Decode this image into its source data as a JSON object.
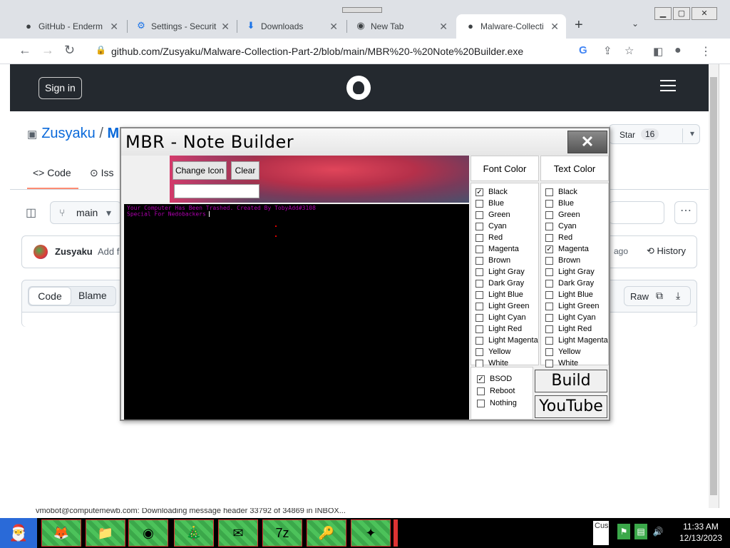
{
  "browser": {
    "tabs": [
      {
        "title": "GitHub - Enderm",
        "icon": "github-icon"
      },
      {
        "title": "Settings - Securit",
        "icon": "gear-icon"
      },
      {
        "title": "Downloads",
        "icon": "download-icon"
      },
      {
        "title": "New Tab",
        "icon": "chrome-icon"
      },
      {
        "title": "Malware-Collecti",
        "icon": "github-icon",
        "active": true
      }
    ],
    "url": "github.com/Zusyaku/Malware-Collection-Part-2/blob/main/MBR%20-%20Note%20Builder.exe",
    "google_badge": "G"
  },
  "github": {
    "signin": "Sign in",
    "repo_owner": "Zusyaku",
    "repo_sep": "/",
    "repo_name_initial": "M",
    "star_label": "Star",
    "star_count": "16",
    "tabs": {
      "code": "Code",
      "issues": "Iss"
    },
    "branch": "main",
    "commit_user": "Zusyaku",
    "commit_msg": "Add f",
    "commit_ago": "ago",
    "history": "History",
    "view_code": "Code",
    "view_blame": "Blame",
    "raw": "Raw"
  },
  "mbr": {
    "title": "MBR - Note Builder",
    "close": "✕",
    "change_icon": "Change Icon",
    "clear": "Clear",
    "note_line1": "Your Computer Has Been Trashed. Created By TobyAdd#3108",
    "note_line2": "Special For Nedobackers",
    "font_color_label": "Font Color",
    "text_color_label": "Text Color",
    "colors": [
      "Black",
      "Blue",
      "Green",
      "Cyan",
      "Red",
      "Magenta",
      "Brown",
      "Light Gray",
      "Dark Gray",
      "Light Blue",
      "Light Green",
      "Light Cyan",
      "Light Red",
      "Light Magenta",
      "Yellow",
      "White"
    ],
    "font_color_checked": "Black",
    "text_color_checked": "Magenta",
    "modes": [
      {
        "label": "BSOD",
        "checked": true
      },
      {
        "label": "Reboot",
        "checked": false
      },
      {
        "label": "Nothing",
        "checked": false
      }
    ],
    "build": "Build",
    "youtube": "YouTube"
  },
  "status": {
    "text": "vmobot@computemewb.com: Downloading message header 33792 of 34869 in INBOX..."
  },
  "taskbar": {
    "search_stub": "Cus",
    "time": "11:33 AM",
    "date": "12/13/2023"
  }
}
